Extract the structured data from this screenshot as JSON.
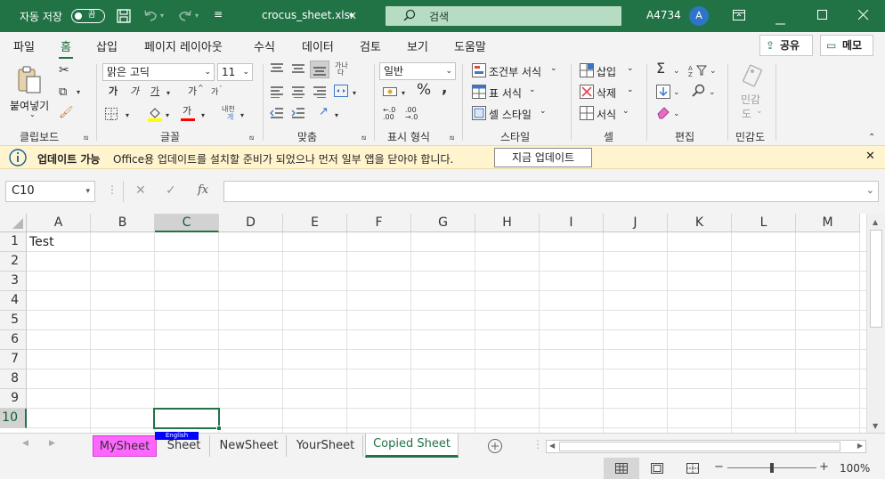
{
  "titlebar": {
    "autosave_label": "자동 저장",
    "autosave_state": "끔",
    "filename": "crocus_sheet.xlsx",
    "search_placeholder": "검색",
    "user_id": "A4734",
    "avatar_initial": "A"
  },
  "menu": {
    "tabs": [
      "파일",
      "홈",
      "삽입",
      "페이지 레이아웃",
      "수식",
      "데이터",
      "검토",
      "보기",
      "도움말"
    ],
    "active_tab": "홈",
    "share_label": "공유",
    "memo_label": "메모"
  },
  "ribbon": {
    "paste_label": "붙여넣기",
    "font_name": "맑은 고딕",
    "font_size": "11",
    "number_format": "일반",
    "bold_glyph": "가",
    "italic_glyph": "가",
    "underline_glyph": "가",
    "grow_glyph": "가",
    "shrink_glyph": "가",
    "font_color_glyph": "가",
    "phonetic_top": "내천",
    "phonetic_bottom": "개",
    "wrap_top": "가나",
    "wrap_bottom": "다",
    "conditional_format": "조건부 서식",
    "format_as_table": "표 서식",
    "cell_styles": "셀 스타일",
    "insert": "삽입",
    "delete": "삭제",
    "format": "서식",
    "sensitivity_top": "민감",
    "sensitivity_bottom": "도",
    "groups": {
      "clipboard": "클립보드",
      "font": "글꼴",
      "alignment": "맞춤",
      "number": "표시 형식",
      "styles": "스타일",
      "cells": "셀",
      "editing": "편집",
      "sensitivity": "민감도"
    }
  },
  "infobar": {
    "title": "업데이트 가능",
    "message": "Office용 업데이트를 설치할 준비가 되었으나 먼저 일부 앱을 닫아야 합니다.",
    "button": "지금 업데이트"
  },
  "formula_bar": {
    "name_box": "C10",
    "fx_label": "fx",
    "formula": ""
  },
  "grid": {
    "columns": [
      "A",
      "B",
      "C",
      "D",
      "E",
      "F",
      "G",
      "H",
      "I",
      "J",
      "K",
      "L",
      "M"
    ],
    "rows": [
      "1",
      "2",
      "3",
      "4",
      "5",
      "6",
      "7",
      "8",
      "9",
      "10"
    ],
    "selected_column": "C",
    "selected_row": "10",
    "cells": {
      "A1": "Test"
    }
  },
  "sheets": {
    "tabs": [
      "MySheet",
      "Sheet",
      "NewSheet",
      "YourSheet",
      "Copied Sheet"
    ],
    "active": "Copied Sheet",
    "highlight_tab": "MySheet",
    "highlight_color": "#ff66ff",
    "ime_badge": "English"
  },
  "statusbar": {
    "zoom": "100%"
  },
  "colors": {
    "brand": "#217346",
    "infobar_bg": "#fff4ce",
    "ime_badge_bg": "#0000ff"
  }
}
